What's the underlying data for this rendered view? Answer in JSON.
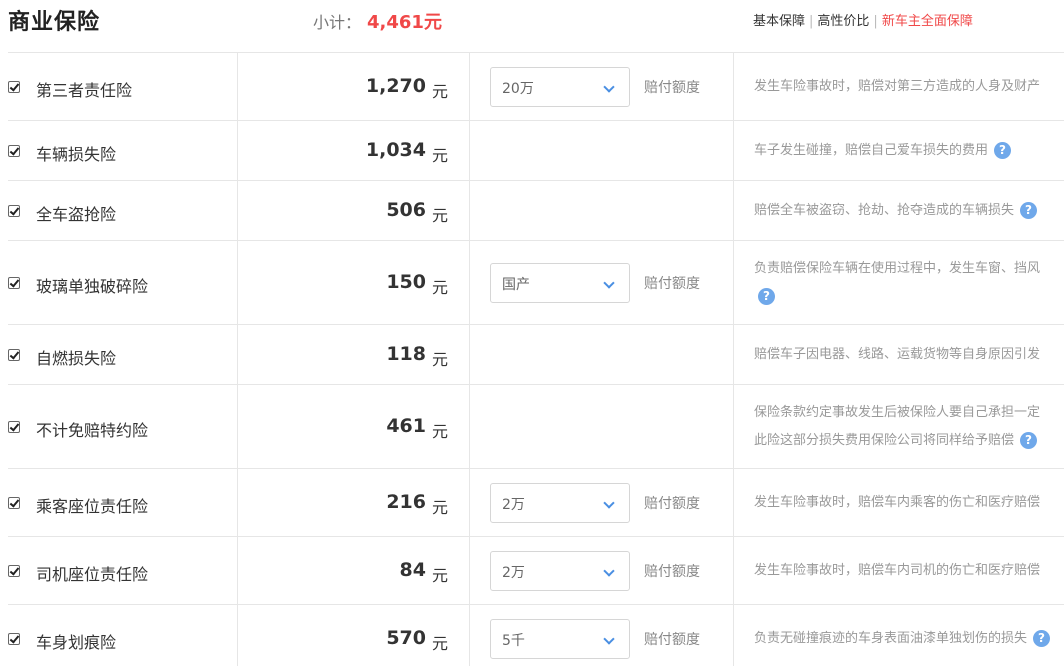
{
  "header": {
    "title": "商业保险",
    "subtotal_label": "小计：",
    "subtotal_amount": "4,461元",
    "tabs": [
      "基本保障",
      "高性价比",
      "新车主全面保障"
    ]
  },
  "unit": "元",
  "pay_label": "赔付额度",
  "help_icon_text": "?",
  "rows": [
    {
      "name": "第三者责任险",
      "price": "1,270",
      "select": "20万",
      "desc": "发生车险事故时，赔偿对第三方造成的人身及财产"
    },
    {
      "name": "车辆损失险",
      "price": "1,034",
      "desc": "车子发生碰撞，赔偿自己爱车损失的费用"
    },
    {
      "name": "全车盗抢险",
      "price": "506",
      "desc": "赔偿全车被盗窃、抢劫、抢夺造成的车辆损失"
    },
    {
      "name": "玻璃单独破碎险",
      "price": "150",
      "select": "国产",
      "desc": "负责赔偿保险车辆在使用过程中，发生车窗、挡风"
    },
    {
      "name": "自燃损失险",
      "price": "118",
      "desc": "赔偿车子因电器、线路、运载货物等自身原因引发"
    },
    {
      "name": "不计免赔特约险",
      "price": "461",
      "desc": "保险条款约定事故发生后被保险人要自己承担一定",
      "desc2": "此险这部分损失费用保险公司将同样给予赔偿"
    },
    {
      "name": "乘客座位责任险",
      "price": "216",
      "select": "2万",
      "desc": "发生车险事故时，赔偿车内乘客的伤亡和医疗赔偿"
    },
    {
      "name": "司机座位责任险",
      "price": "84",
      "select": "2万",
      "desc": "发生车险事故时，赔偿车内司机的伤亡和医疗赔偿"
    },
    {
      "name": "车身划痕险",
      "price": "570",
      "select": "5千",
      "desc": "负责无碰撞痕迹的车身表面油漆单独划伤的损失"
    }
  ]
}
